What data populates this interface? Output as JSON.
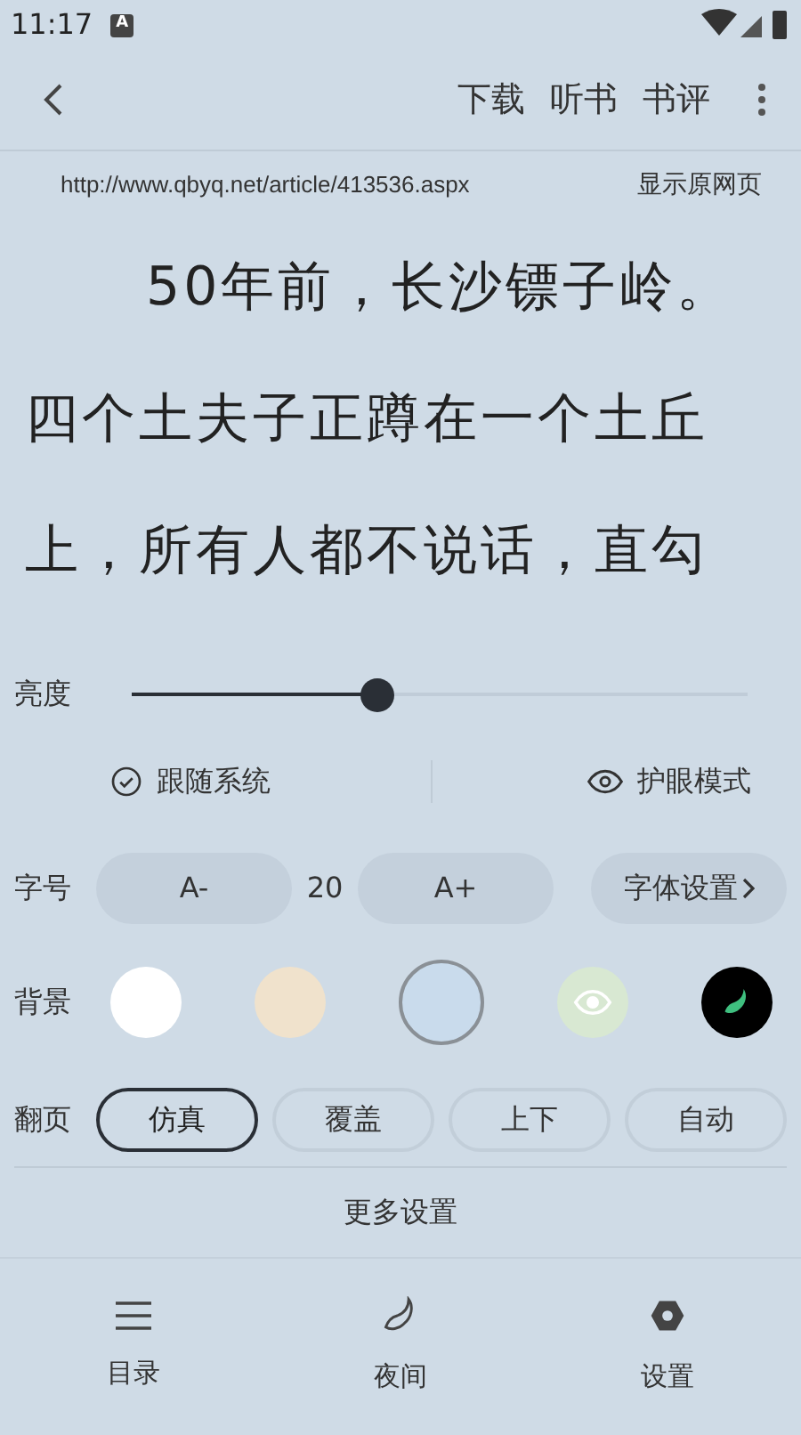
{
  "status_bar": {
    "time": "11:17",
    "notification": "A"
  },
  "toolbar": {
    "actions": [
      "下载",
      "听书",
      "书评"
    ]
  },
  "source": {
    "url": "http://www.qbyq.net/article/413536.aspx",
    "link": "显示原网页"
  },
  "article": {
    "paragraphs": [
      {
        "indent": true,
        "lines": [
          "50年前，长沙镖子岭。"
        ]
      },
      {
        "indent": false,
        "lines": [
          "四个土夫子正蹲在一个土丘",
          "上，所有人都不说话，直勾"
        ]
      }
    ]
  },
  "brightness": {
    "label": "亮度",
    "level": 0.4
  },
  "brightness_options": [
    {
      "kind": "check",
      "label": "跟随系统"
    },
    {
      "kind": "eye",
      "label": "护眼模式"
    }
  ],
  "font_size": {
    "label": "字号",
    "decrease": "A-",
    "value": "20",
    "increase": "A+",
    "settings": "字体设置"
  },
  "background": {
    "label": "背景",
    "options": [
      {
        "kind": "plain",
        "color": "#ffffff",
        "selected": false
      },
      {
        "kind": "plain",
        "color": "#f0e2cc",
        "selected": false
      },
      {
        "kind": "plain",
        "color": "#c9dbec",
        "selected": true
      },
      {
        "kind": "eye",
        "color": "#d8e8d2",
        "selected": false
      },
      {
        "kind": "moon",
        "color": "#000000",
        "selected": false
      }
    ]
  },
  "page_turn": {
    "label": "翻页",
    "options": [
      {
        "label": "仿真",
        "selected": true
      },
      {
        "label": "覆盖",
        "selected": false
      },
      {
        "label": "上下",
        "selected": false
      },
      {
        "label": "自动",
        "selected": false
      }
    ]
  },
  "more_settings": "更多设置",
  "bottom_nav": [
    {
      "kind": "menu",
      "label": "目录"
    },
    {
      "kind": "moon",
      "label": "夜间"
    },
    {
      "kind": "gear",
      "label": "设置"
    }
  ]
}
